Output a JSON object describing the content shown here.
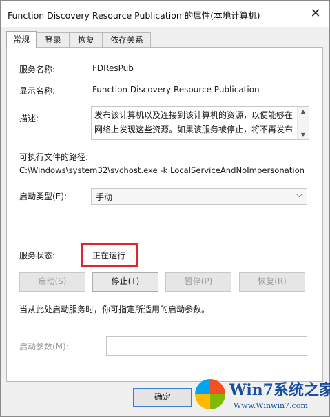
{
  "window": {
    "title": "Function Discovery Resource Publication 的属性(本地计算机)",
    "close_glyph": "✕"
  },
  "tabs": [
    {
      "label": "常规",
      "active": true
    },
    {
      "label": "登录",
      "active": false
    },
    {
      "label": "恢复",
      "active": false
    },
    {
      "label": "依存关系",
      "active": false
    }
  ],
  "general": {
    "service_name_label": "服务名称:",
    "service_name": "FDResPub",
    "display_name_label": "显示名称:",
    "display_name": "Function Discovery Resource Publication",
    "description_label": "描述:",
    "description": "发布该计算机以及连接到该计算机的资源，以便能够在网络上发现这些资源。如果该服务被停止，将不再发布",
    "exe_path_label": "可执行文件的路径:",
    "exe_path": "C:\\Windows\\system32\\svchost.exe -k LocalServiceAndNoImpersonation",
    "startup_type_label": "启动类型(E):",
    "startup_type_value": "手动",
    "service_status_label": "服务状态:",
    "service_status_value": "正在运行",
    "buttons": {
      "start": "启动(S)",
      "stop": "停止(T)",
      "pause": "暂停(P)",
      "resume": "恢复(R)"
    },
    "note": "当从此处启动服务时，你可指定所适用的启动参数。",
    "start_params_label": "启动参数(M):",
    "start_params_value": ""
  },
  "footer": {
    "ok_label": "确定"
  },
  "watermark": {
    "brand": "Win7系统之家",
    "url": "Www.Winwin7.com"
  },
  "colors": {
    "highlight_red": "#e0232c",
    "default_button_border": "#3c7fd0"
  }
}
